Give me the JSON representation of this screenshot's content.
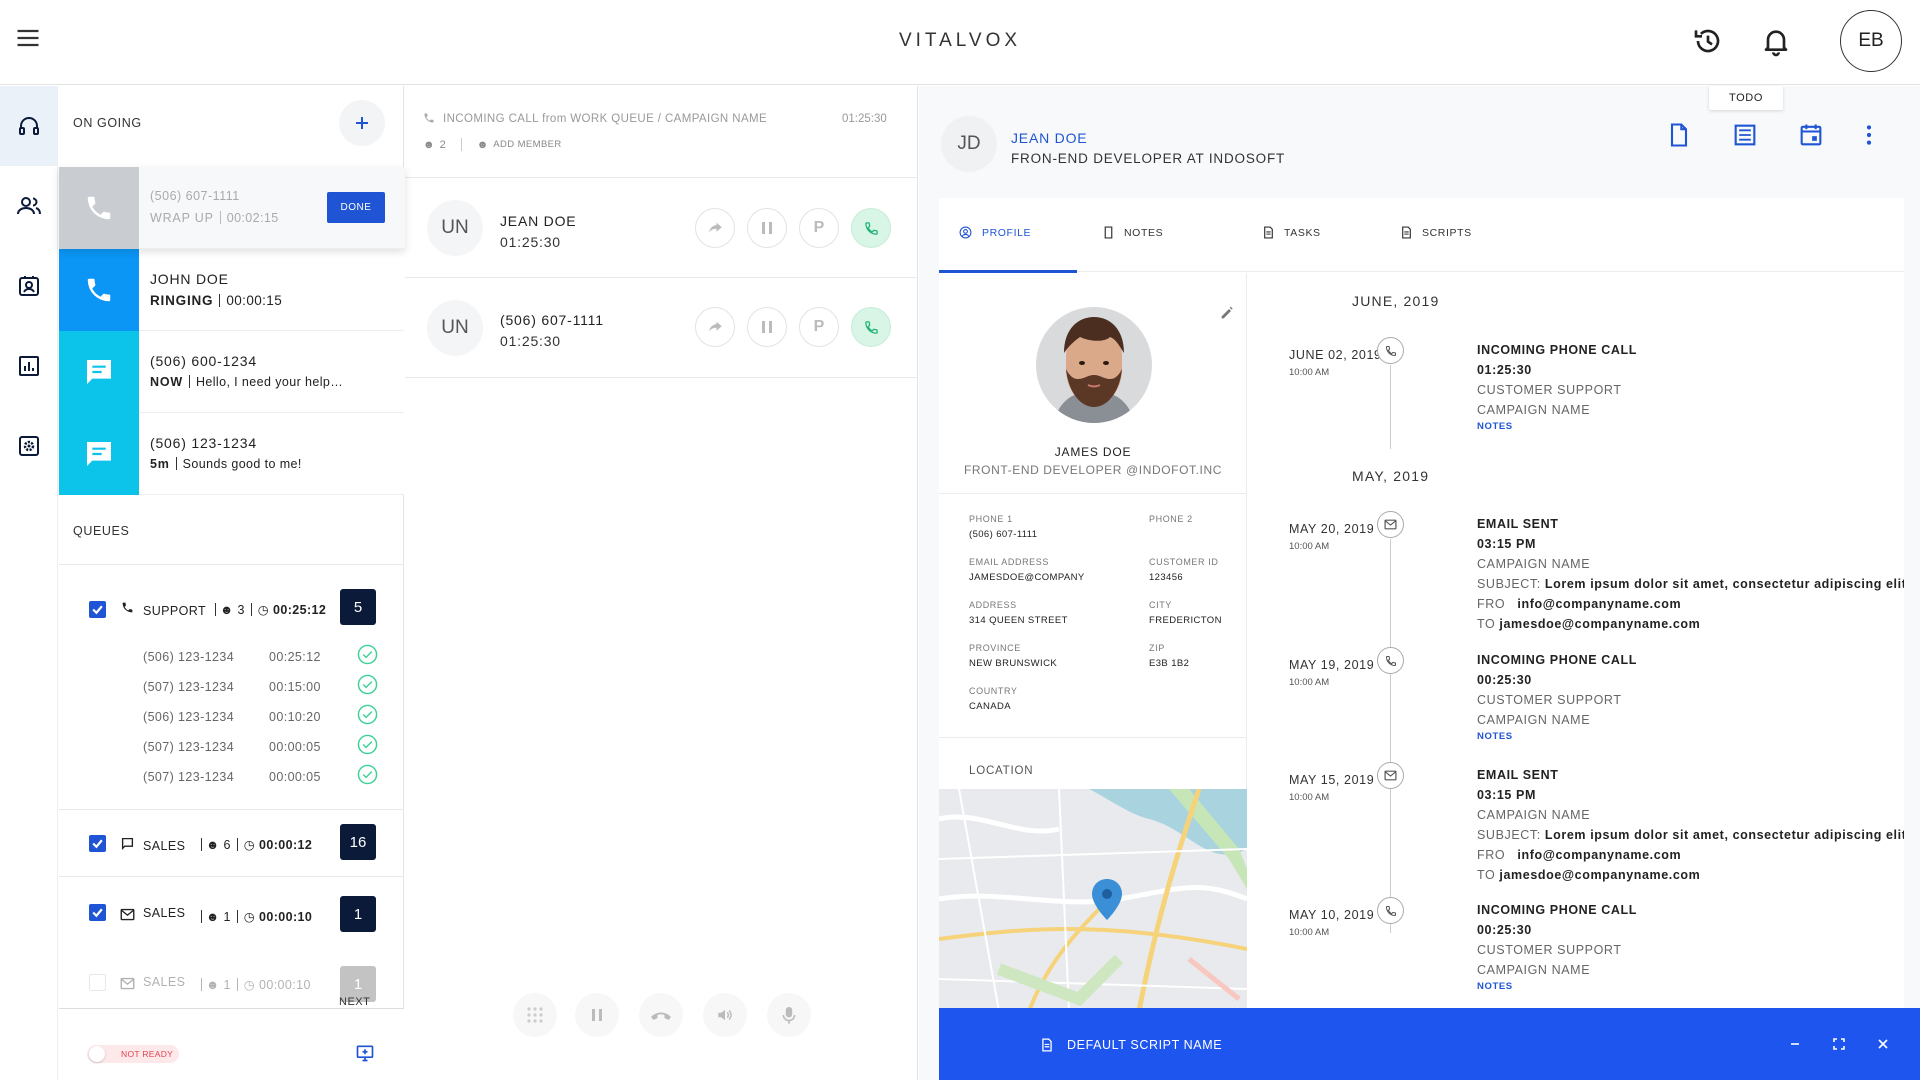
{
  "app": {
    "title": "VITALVOX",
    "user_initials": "EB"
  },
  "colors": {
    "accent": "#1f55d4",
    "call_ringing": "#0b95f5",
    "chat": "#0cc3ea",
    "wrapup": "#c9cdd2",
    "badge": "#0c1a3a",
    "success": "#3bd195",
    "danger": "#e0464f",
    "script_bar": "#1f55ef"
  },
  "rail": {
    "items": [
      "headset-icon",
      "contacts-icon",
      "address-book-icon",
      "analytics-icon",
      "settings-icon"
    ]
  },
  "ongoing": {
    "title": "ON GOING",
    "items": [
      {
        "type": "wrapup",
        "line1": "(506) 607-1111",
        "status": "WRAP UP",
        "duration": "00:02:15",
        "action": "DONE"
      },
      {
        "type": "call",
        "line1": "JOHN DOE",
        "status": "RINGING",
        "duration": "00:00:15"
      },
      {
        "type": "chat",
        "line1": "(506) 600-1234",
        "status": "NOW",
        "preview": "Hello, I need your help…"
      },
      {
        "type": "chat",
        "line1": "(506) 123-1234",
        "status": "5m",
        "preview": "Sounds good to me!"
      }
    ]
  },
  "queues": {
    "title": "QUEUES",
    "groups": [
      {
        "name": "SUPPORT",
        "members": "3",
        "wait": "00:25:12",
        "count": "5",
        "rows": [
          {
            "phone": "(506) 123-1234",
            "time": "00:25:12"
          },
          {
            "phone": "(507) 123-1234",
            "time": "00:15:00"
          },
          {
            "phone": "(506) 123-1234",
            "time": "00:10:20"
          },
          {
            "phone": "(507) 123-1234",
            "time": "00:00:05"
          },
          {
            "phone": "(507) 123-1234",
            "time": "00:00:05"
          }
        ]
      },
      {
        "name": "SALES",
        "members": "6",
        "wait": "00:00:12",
        "count": "16"
      },
      {
        "name": "SALES",
        "members": "1",
        "wait": "00:00:10",
        "count": "1"
      },
      {
        "name": "SALES",
        "members": "1",
        "wait": "00:00:10",
        "count": "1"
      }
    ],
    "next_label": "NEXT"
  },
  "status": {
    "label": "NOT READY"
  },
  "call_panel": {
    "incoming": "INCOMING CALL from WORK QUEUE / CAMPAIGN NAME",
    "incoming_time": "01:25:30",
    "participants": "2",
    "add_member": "ADD MEMBER",
    "calls": [
      {
        "initials": "UN",
        "name": "JEAN DOE",
        "time": "01:25:30"
      },
      {
        "initials": "UN",
        "name": "(506) 607-1111",
        "time": "01:25:30"
      }
    ],
    "park_label": "P"
  },
  "contact": {
    "initials": "JD",
    "name": "JEAN DOE",
    "role": "FRON-END DEVELOPER AT INDOSOFT",
    "todo_tooltip": "TODO",
    "tabs": [
      "PROFILE",
      "NOTES",
      "TASKS",
      "SCRIPTS"
    ],
    "profile": {
      "name": "JAMES DOE",
      "role": "FRONT-END DEVELOPER @INDOFOT.INC",
      "fields": [
        {
          "label": "PHONE 1",
          "value": "(506) 607-1111"
        },
        {
          "label": "PHONE 2",
          "value": ""
        },
        {
          "label": "EMAIL ADDRESS",
          "value": "JAMESDOE@COMPANY"
        },
        {
          "label": "CUSTOMER ID",
          "value": "123456"
        },
        {
          "label": "ADDRESS",
          "value": "314 QUEEN STREET"
        },
        {
          "label": "CITY",
          "value": "FREDERICTON"
        },
        {
          "label": "PROVINCE",
          "value": "NEW BRUNSWICK"
        },
        {
          "label": "ZIP",
          "value": "E3B 1B2"
        },
        {
          "label": "COUNTRY",
          "value": "CANADA"
        }
      ],
      "location_title": "LOCATION"
    },
    "timeline": {
      "months": [
        "JUNE, 2019",
        "MAY, 2019"
      ],
      "events": [
        {
          "date": "JUNE 02, 2019",
          "time": "10:00 AM",
          "kind": "phone",
          "title": "INCOMING PHONE CALL",
          "detail": "01:25:30",
          "line3": "CUSTOMER SUPPORT",
          "line4": "CAMPAIGN NAME",
          "notes": "NOTES"
        },
        {
          "date": "MAY 20, 2019",
          "time": "10:00 AM",
          "kind": "email",
          "title": "EMAIL SENT",
          "detail": "03:15 PM",
          "line3": "CAMPAIGN NAME",
          "subject_label": "SUBJECT:",
          "subject": "Lorem ipsum dolor sit amet, consectetur adipiscing elit.",
          "from_label": "FRO",
          "from": "info@companyname.com",
          "to_label": "TO",
          "to": "jamesdoe@companyname.com"
        },
        {
          "date": "MAY 19, 2019",
          "time": "10:00 AM",
          "kind": "phone",
          "title": "INCOMING PHONE CALL",
          "detail": "00:25:30",
          "line3": "CUSTOMER SUPPORT",
          "line4": "CAMPAIGN NAME",
          "notes": "NOTES"
        },
        {
          "date": "MAY 15, 2019",
          "time": "10:00 AM",
          "kind": "email",
          "title": "EMAIL SENT",
          "detail": "03:15 PM",
          "line3": "CAMPAIGN NAME",
          "subject_label": "SUBJECT:",
          "subject": "Lorem ipsum dolor sit amet, consectetur adipiscing elit.",
          "from_label": "FRO",
          "from": "info@companyname.com",
          "to_label": "TO",
          "to": "jamesdoe@companyname.com"
        },
        {
          "date": "MAY 10, 2019",
          "time": "10:00 AM",
          "kind": "phone",
          "title": "INCOMING PHONE CALL",
          "detail": "00:25:30",
          "line3": "CUSTOMER SUPPORT",
          "line4": "CAMPAIGN NAME",
          "notes": "NOTES"
        }
      ]
    },
    "script_bar": {
      "title": "DEFAULT SCRIPT NAME"
    }
  }
}
